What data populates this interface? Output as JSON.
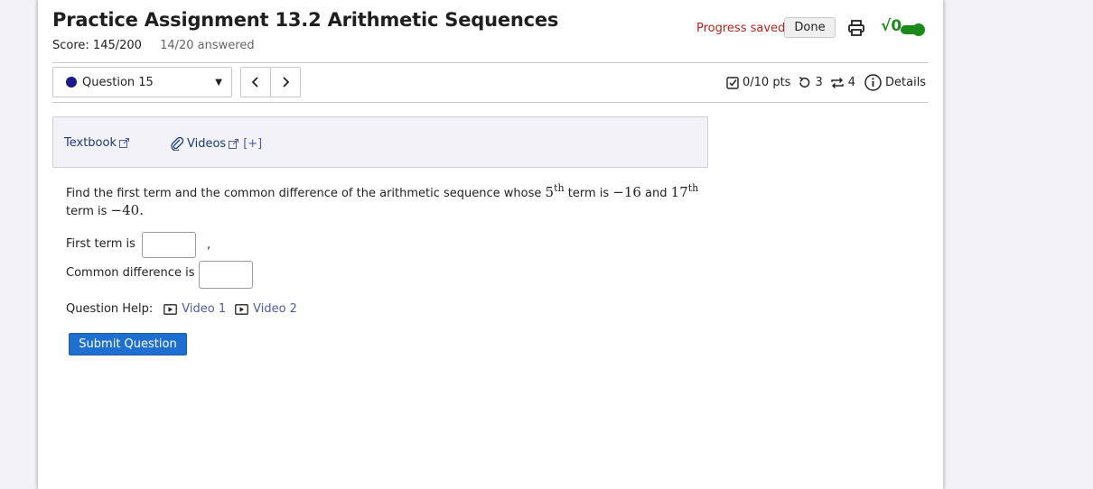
{
  "header": {
    "title": "Practice Assignment 13.2 Arithmetic Sequences",
    "score": "Score: 145/200",
    "answered": "14/20 answered",
    "progress_status": "Progress saved",
    "done_label": "Done",
    "math_toggle_label": "√0"
  },
  "question_nav": {
    "selected": "Question 15",
    "prev_glyph": "‹",
    "next_glyph": "›"
  },
  "question_meta": {
    "points": "0/10 pts",
    "retries": "3",
    "attempts": "4",
    "details_label": "Details"
  },
  "resources": {
    "textbook_label": "Textbook",
    "videos_label": "Videos",
    "expand_label": "[+]"
  },
  "question": {
    "text_1": "Find the first term and the common difference of the arithmetic sequence whose ",
    "term_a": "5",
    "sup_a": "th",
    "text_2": " term is ",
    "value_a": "−16",
    "text_3": " and ",
    "term_b": "17",
    "sup_b": "th",
    "text_4": " term is ",
    "value_b": "−40",
    "text_5": "."
  },
  "answers": {
    "first_term_label": "First term is",
    "first_term_value": "",
    "separator": ",",
    "common_difference_label": "Common difference is",
    "common_difference_value": ""
  },
  "help": {
    "label": "Question Help:",
    "video_1": "Video 1",
    "video_2": "Video 2"
  },
  "submit_label": "Submit Question",
  "colors": {
    "accent": "#1f6fd1",
    "progress_text": "#b3261e",
    "toggle_green": "#1a8a1a",
    "link": "#1d3c78"
  }
}
